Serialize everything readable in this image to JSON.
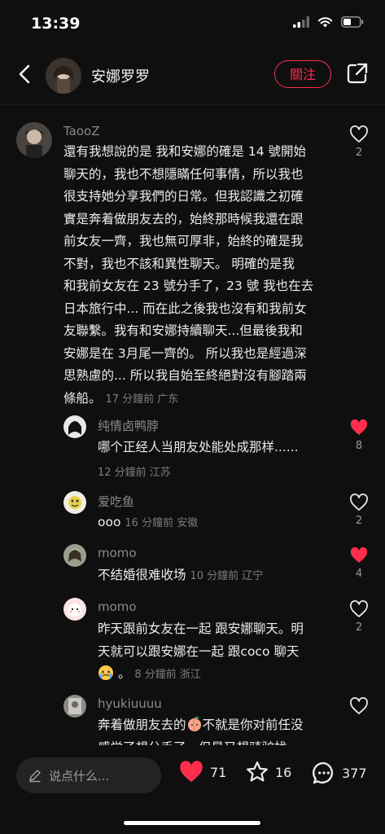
{
  "status": {
    "time": "13:39"
  },
  "header": {
    "title": "安娜罗罗",
    "follow_label": "關注"
  },
  "comments": [
    {
      "user": "TaooZ",
      "lines": [
        "還有我想說的是 我和安娜的確是 14 號開始",
        "聊天的，我也不想隱瞞任何事情，所以我也",
        "很支持她分享我們的日常。但我認識之初確",
        "實是奔着做朋友去的，始終那時候我還在跟",
        "前女友一齊，我也無可厚非，始終的確是我",
        "不對，我也不該和異性聊天。 明確的是我",
        "和我前女友在 23 號分手了，23 號 我也在去",
        "日本旅行中... 而在此之後我也沒有和我前女",
        "友聯繫。我有和安娜持續聊天...但最後我和",
        "安娜是在 3月尾一齊的。 所以我也是經過深",
        "思熟慮的... 所以我自始至終絕對沒有腳踏兩"
      ],
      "last_line": "條船。",
      "meta": "17 分鐘前 广东",
      "likes": "2",
      "liked": false
    },
    {
      "user": "纯情卤鸭脖",
      "text": "哪个正经人当朋友处能处成那样......",
      "meta": "12 分鐘前 江苏",
      "likes": "8",
      "liked": true
    },
    {
      "user": "爱吃鱼",
      "text": "ooo",
      "meta": "16 分鐘前 安徽",
      "likes": "2",
      "liked": false
    },
    {
      "user": "momo",
      "text": "不结婚很难收场",
      "meta": "10 分鐘前 辽宁",
      "likes": "4",
      "liked": true
    },
    {
      "user": "momo",
      "line1": "昨天跟前女友在一起 跟安娜聊天。明",
      "line2": "天就可以跟安娜在一起 跟coco 聊天",
      "meta": "8 分鐘前 浙江",
      "likes": "2",
      "liked": false
    },
    {
      "user": "hyukiuuuu",
      "line1a": "奔着做朋友去的",
      "line1b": "不就是你对前任没",
      "line2": "感觉了想分手了，但是又想骑驴找",
      "liked": false
    }
  ],
  "bottom": {
    "placeholder": "说点什么...",
    "likes": "71",
    "favorites": "16",
    "comments": "377"
  },
  "colors": {
    "accent": "#ff2e4d",
    "background": "#0f0f10"
  }
}
